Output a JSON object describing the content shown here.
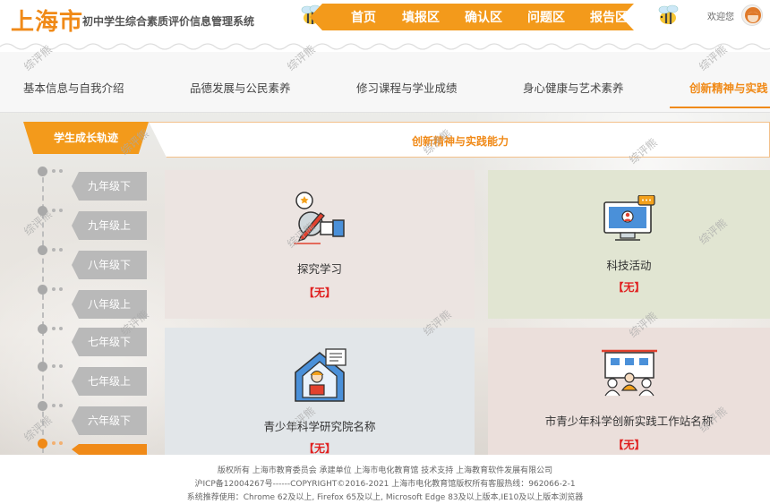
{
  "header": {
    "city": "上海市",
    "system_name": "初中学生综合素质评价信息管理系统",
    "nav": [
      "首页",
      "填报区",
      "确认区",
      "问题区",
      "报告区"
    ],
    "welcome": "欢迎您"
  },
  "tabs": [
    {
      "label": "基本信息与自我介绍"
    },
    {
      "label": "品德发展与公民素养"
    },
    {
      "label": "修习课程与学业成绩"
    },
    {
      "label": "身心健康与艺术素养"
    },
    {
      "label": "创新精神与实践"
    }
  ],
  "active_tab_index": 4,
  "sidebar": {
    "title": "学生成长轨迹",
    "grades": [
      "九年级下",
      "九年级上",
      "八年级下",
      "八年级上",
      "七年级下",
      "七年级上",
      "六年级下",
      ""
    ]
  },
  "banner_title": "创新精神与实践能力",
  "cards": [
    {
      "name": "探究学习",
      "status": "【无】"
    },
    {
      "name": "科技活动",
      "status": "【无】"
    },
    {
      "name": "青少年科学研究院名称",
      "status": "【无】"
    },
    {
      "name": "市青少年科学创新实践工作站名称",
      "status": "【无】"
    }
  ],
  "footer": {
    "line1": "版权所有 上海市教育委员会    承建单位 上海市电化教育馆    技术支持 上海教育软件发展有限公司",
    "line2": "沪ICP备12004267号------COPYRIGHT©2016-2021 上海市电化教育馆版权所有客服热线：962066-2-1",
    "line3": "系统推荐使用：Chrome 62及以上, Firefox 65及以上, Microsoft Edge 83及以上版本,IE10及以上版本浏览器"
  },
  "watermark": "综评熊",
  "colors": {
    "accent": "#f08a18",
    "status_red": "#e02020",
    "grade_gray": "#b9b9b9"
  }
}
